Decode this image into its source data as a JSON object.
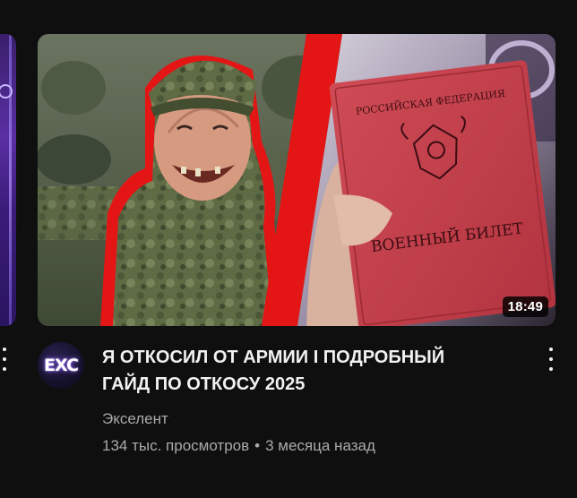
{
  "video": {
    "title": "Я ОТКОСИЛ ОТ АРМИИ I ПОДРОБНЫЙ ГАЙД ПО ОТКОСУ 2025",
    "duration": "18:49",
    "channel": "Экселент",
    "views": "134 тыс. просмотров",
    "separator": "•",
    "age": "3 месяца назад",
    "avatar_logo": "EXC",
    "thumbnail_text": {
      "header": "РОССИЙСКАЯ ФЕДЕРАЦИЯ",
      "card": "ВОЕННЫЙ БИЛЕТ"
    }
  },
  "icons": {
    "more": "more-vert-icon"
  },
  "colors": {
    "background": "#0f0f0f",
    "title": "#f1f1f1",
    "secondary_text": "#aaaaaa",
    "thumbnail_accent": "#e41515",
    "military_id": "#c43f4a"
  }
}
